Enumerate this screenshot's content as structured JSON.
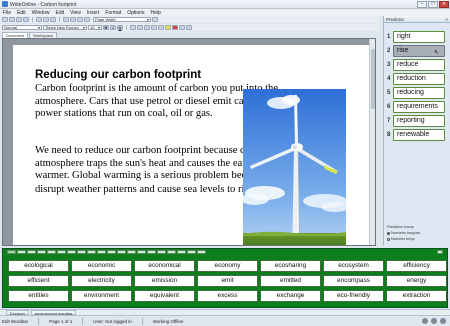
{
  "window": {
    "title": "WriteOnline - Carbon footprint",
    "controls": [
      "–",
      "□",
      "✕"
    ]
  },
  "menu": [
    "File",
    "Edit",
    "Window",
    "Edit",
    "View",
    "Insert",
    "Format",
    "Options",
    "Help"
  ],
  "toolbar": {
    "zoom": "Page Width",
    "style": "Normal",
    "font": "Times New Roman",
    "size": "16",
    "bold": "B",
    "italic": "I",
    "underline": "U"
  },
  "doc_tabs": [
    "Document",
    "Workspace"
  ],
  "document": {
    "heading": "Reducing our carbon footprint",
    "paragraph1": "Carbon footprint is the amount of carbon you put into the atmosphere.  Cars that use petrol or diesel emit carbon, and so do power stations that run on coal, oil or gas.",
    "paragraph2": "We need to reduce our carbon footprint because carbon in the atmosphere traps the sun's heat and causes the earth to get warmer. Global warming is a serious problem because it will disrupt weather patterns and cause sea levels to ri"
  },
  "predictor": {
    "title": "Predictor",
    "selected_index": 2,
    "items": [
      {
        "num": "1",
        "word": "right"
      },
      {
        "num": "2",
        "word": "rise"
      },
      {
        "num": "3",
        "word": "reduce"
      },
      {
        "num": "4",
        "word": "reduction"
      },
      {
        "num": "5",
        "word": "reducing"
      },
      {
        "num": "6",
        "word": "requirements"
      },
      {
        "num": "7",
        "word": "reporting"
      },
      {
        "num": "8",
        "word": "renewable"
      }
    ],
    "focus_label": "Predictor focus",
    "focus_options": [
      "Numeric keypad",
      "Number keys"
    ]
  },
  "wordbank": {
    "rows": [
      [
        "ecological",
        "economic",
        "economical",
        "economy",
        "ecosharing",
        "ecosystem",
        "efficiency"
      ],
      [
        "efficient",
        "electricity",
        "emission",
        "emit",
        "emitted",
        "encompass",
        "energy"
      ],
      [
        "entities",
        "environment",
        "equivalent",
        "excess",
        "exchange",
        "eco-friendly",
        "extraction"
      ]
    ]
  },
  "taskbar": [
    "Explorer",
    "environment wordbar"
  ],
  "status": {
    "edit_wordbar": "Edit Wordbar",
    "page": "Page 1 of 1",
    "user": "User: Not logged in",
    "mode": "Working Offline"
  },
  "colors": {
    "wordbank_bg": "#0c7f1c",
    "predictor_border": "#5a8e3a",
    "selected_prediction": "#a9afb6"
  }
}
